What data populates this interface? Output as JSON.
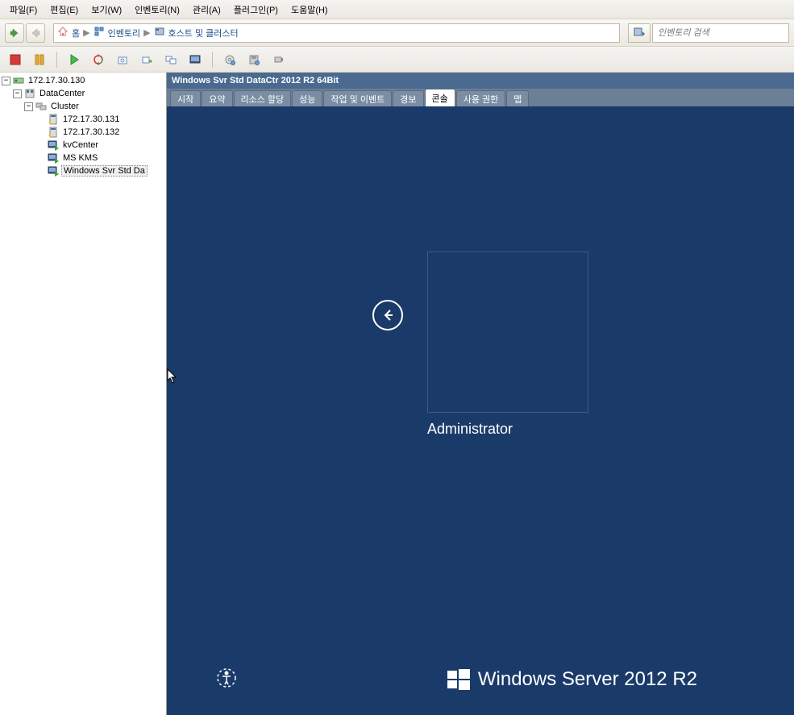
{
  "menu": {
    "file": "파일(F)",
    "edit": "편집(E)",
    "view": "보기(W)",
    "inventory": "인벤토리(N)",
    "admin": "관리(A)",
    "plugins": "플러그인(P)",
    "help": "도움말(H)"
  },
  "breadcrumb": {
    "home": "홈",
    "inventory": "인벤토리",
    "hosts_clusters": "호스트 및 클러스터"
  },
  "search": {
    "placeholder": "인벤토리 검색"
  },
  "tree": {
    "root": "172.17.30.130",
    "datacenter": "DataCenter",
    "cluster": "Cluster",
    "host1": "172.17.30.131",
    "host2": "172.17.30.132",
    "vm1": "kvCenter",
    "vm2": "MS KMS",
    "vm3": "Windows Svr Std Da"
  },
  "content": {
    "title": "Windows Svr Std DataCtr 2012 R2 64Bit"
  },
  "tabs": {
    "start": "시작",
    "summary": "요약",
    "resource": "리소스 할당",
    "perf": "성능",
    "tasks": "작업 및 이벤트",
    "alerts": "경보",
    "console": "콘솔",
    "perms": "사용 권한",
    "maps": "맵"
  },
  "console": {
    "user": "Administrator",
    "brand_main": "Windows Server",
    "brand_year": "2012",
    "brand_r2": "R2"
  }
}
